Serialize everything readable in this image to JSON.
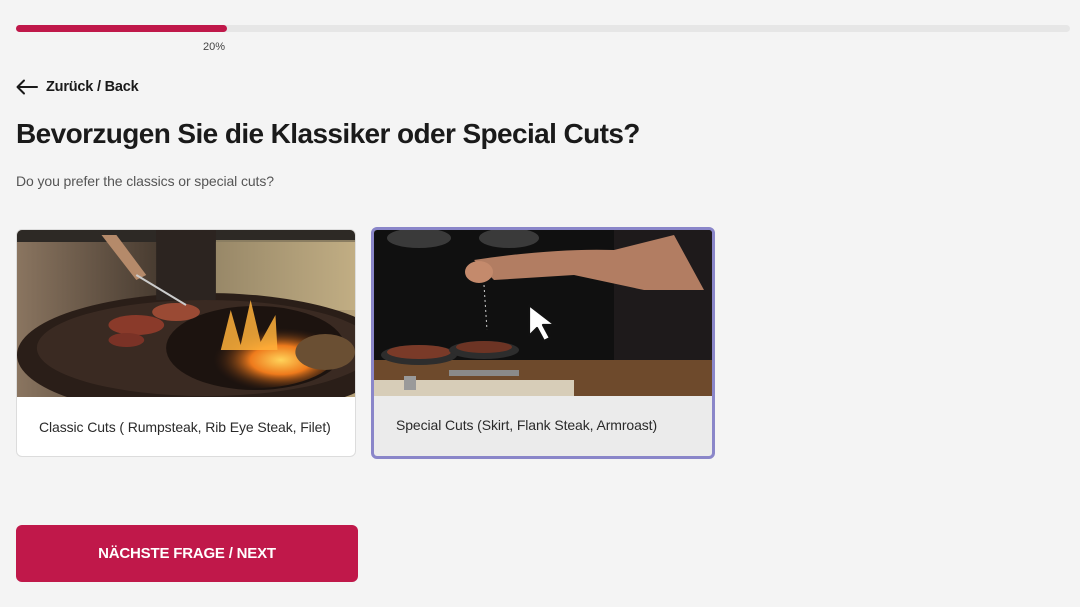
{
  "progress": {
    "percent": 20,
    "label": "20%"
  },
  "navigation": {
    "back_label": "Zurück / Back",
    "back_icon": "arrow-left-icon"
  },
  "question": {
    "title": "Bevorzugen Sie die Klassiker oder Special Cuts?",
    "subtitle": "Do you prefer the classics or special cuts?"
  },
  "options": [
    {
      "label": "Classic Cuts ( Rumpsteak, Rib Eye Steak, Filet)",
      "selected": false
    },
    {
      "label": "Special Cuts (Skirt, Flank Steak, Armroast)",
      "selected": true
    }
  ],
  "next_button": {
    "label": "NÄCHSTE FRAGE / NEXT"
  },
  "colors": {
    "accent": "#c0184a",
    "selected_border": "#8a86c9",
    "background": "#f4f4f4"
  }
}
